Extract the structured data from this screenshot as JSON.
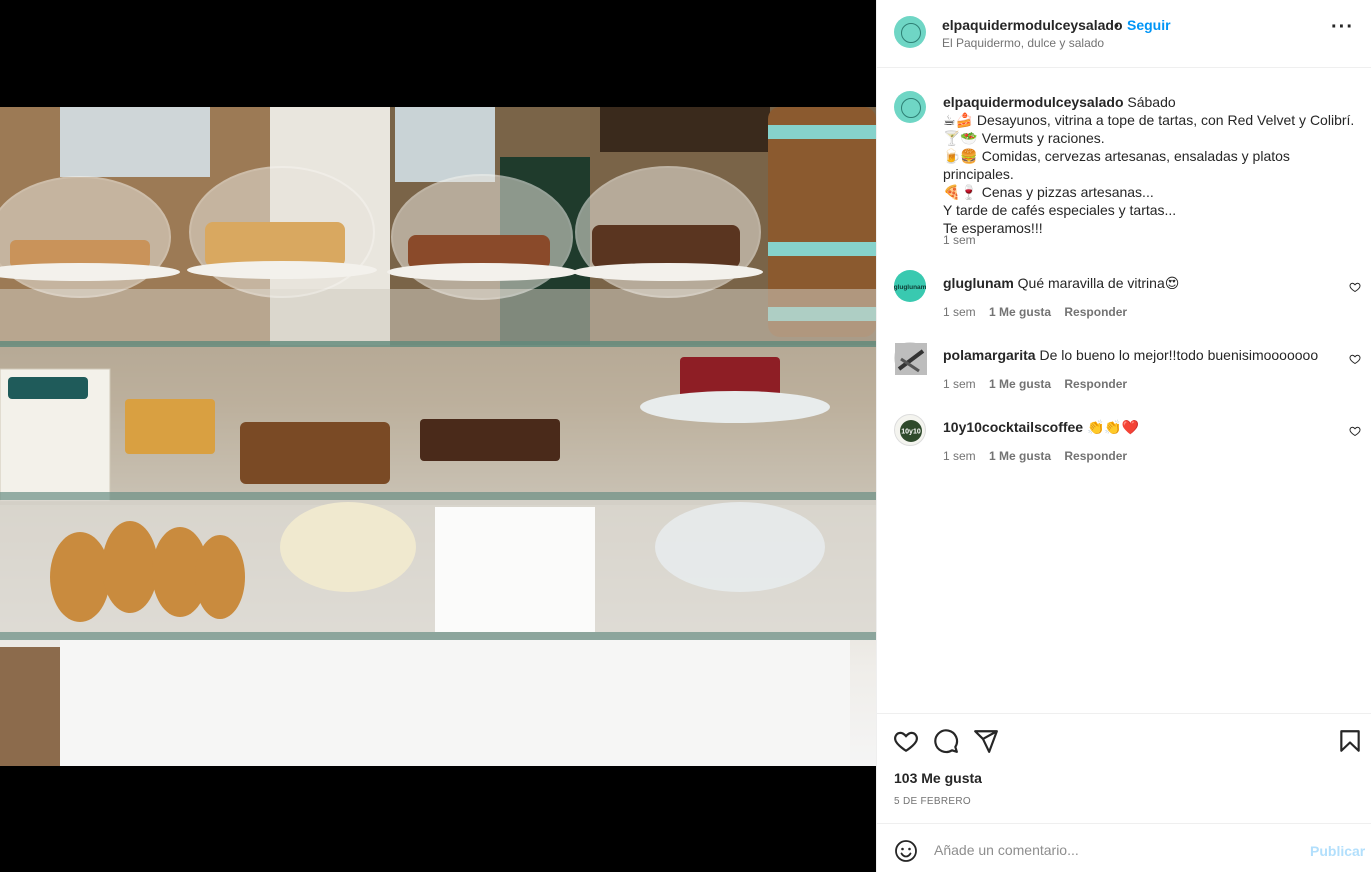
{
  "post": {
    "username": "elpaquidermodulceysalado",
    "separator": "•",
    "follow_label": "Seguir",
    "location": "El Paquidermo, dulce y salado",
    "more_icon": "more-horizontal-icon"
  },
  "caption": {
    "username": "elpaquidermodulceysalado",
    "lines": [
      "Sábado",
      "☕🍰 Desayunos, vitrina a tope de tartas, con Red Velvet y Colibrí.",
      "🍸🥗 Vermuts y raciones.",
      "🍺🍔 Comidas, cervezas artesanas, ensaladas y platos principales.",
      "🍕🍷 Cenas y pizzas artesanas...",
      "Y tarde de cafés especiales y tartas...",
      "Te esperamos!!!"
    ],
    "time": "1 sem"
  },
  "comments": [
    {
      "username": "gluglunam",
      "text": "Qué maravilla de vitrina😍",
      "time": "1 sem",
      "likes": "1 Me gusta",
      "reply": "Responder",
      "avatar_color": "#39c9b0",
      "avatar_text": "gluglunam"
    },
    {
      "username": "polamargarita",
      "text": "De lo bueno lo mejor!!todo buenisimooooooo",
      "time": "1 sem",
      "likes": "1 Me gusta",
      "reply": "Responder",
      "avatar_color": "#7a7a7a"
    },
    {
      "username": "10y10cocktailscoffee",
      "text": "👏👏❤️",
      "time": "1 sem",
      "likes": "1 Me gusta",
      "reply": "Responder",
      "avatar_color": "#2f4a2c",
      "avatar_text": "10y10"
    }
  ],
  "actions": {
    "like_icon": "heart-icon",
    "comment_icon": "comment-icon",
    "share_icon": "send-icon",
    "save_icon": "bookmark-icon",
    "likes_count": "103 Me gusta",
    "date": "5 DE FEBRERO"
  },
  "add_comment": {
    "emoji_icon": "emoji-icon",
    "placeholder": "Añade un comentario...",
    "publish_label": "Publicar"
  },
  "colors": {
    "link": "#0095f6",
    "publish_disabled": "#b2dffc",
    "avatar_brand": "#6fd6c5"
  }
}
